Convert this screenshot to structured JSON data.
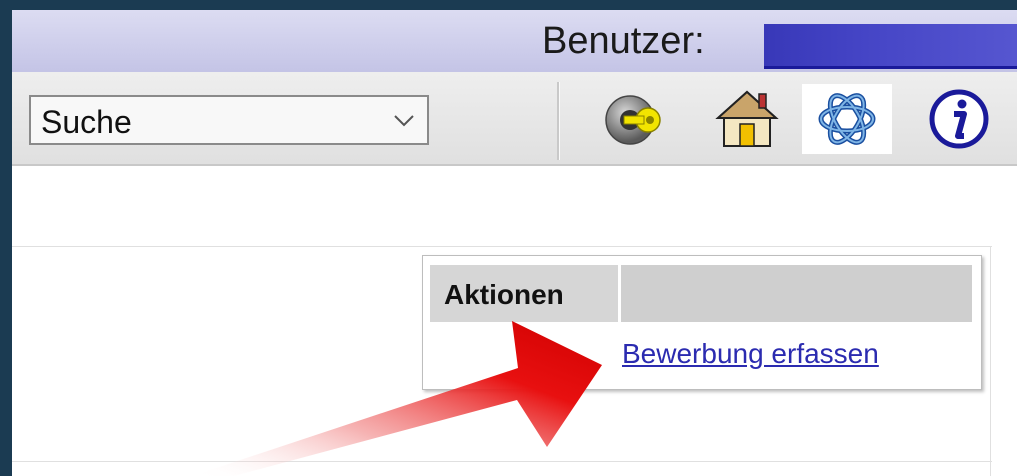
{
  "header": {
    "user_label": "Benutzer:"
  },
  "toolbar": {
    "search_select": {
      "value": "Suche"
    },
    "icons": [
      {
        "name": "login-key-icon"
      },
      {
        "name": "home-icon"
      },
      {
        "name": "logo-knot-icon"
      },
      {
        "name": "info-icon"
      }
    ]
  },
  "actions": {
    "header": "Aktionen",
    "link": "Bewerbung erfassen"
  },
  "colors": {
    "user_bar": "#c8c8e8",
    "user_name_redacted": "#4040c0",
    "link": "#2b2bb0",
    "arrow": "#e00000"
  }
}
